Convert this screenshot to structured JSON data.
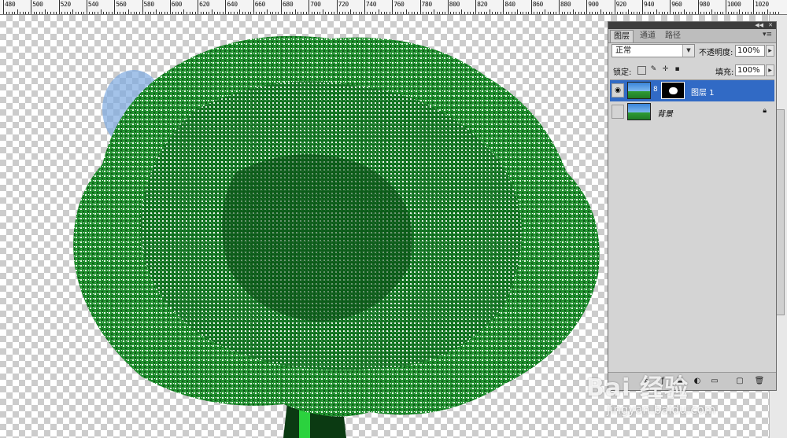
{
  "ruler": {
    "labels": [
      "480",
      "500",
      "520",
      "540",
      "560",
      "580",
      "600",
      "620",
      "640",
      "660",
      "680",
      "700",
      "720",
      "740",
      "760",
      "780",
      "800",
      "820",
      "840",
      "860",
      "880",
      "900",
      "920",
      "940",
      "960",
      "980",
      "1000",
      "1020"
    ]
  },
  "layers_panel": {
    "tabs": [
      "图层",
      "通道",
      "路径"
    ],
    "active_tab": "图层",
    "blend_mode": "正常",
    "opacity_label": "不透明度:",
    "opacity_value": "100%",
    "lock_label": "锁定:",
    "fill_label": "填充:",
    "fill_value": "100%",
    "layers": [
      {
        "name": "图层 1",
        "visible": true,
        "selected": true,
        "has_mask": true
      },
      {
        "name": "背景",
        "visible": false,
        "selected": false,
        "locked": true
      }
    ]
  },
  "watermark": {
    "main": "Bai 经验",
    "sub": "jingyan.baidu.com"
  },
  "colors": {
    "selection": "#316ac5",
    "tree_green": "#1e8f2e",
    "panel_bg": "#d4d4d4"
  },
  "icons": {
    "eye": "eye-icon",
    "chain": "link-icon",
    "lock": "lock-icon",
    "panel_menu": "menu-icon"
  }
}
